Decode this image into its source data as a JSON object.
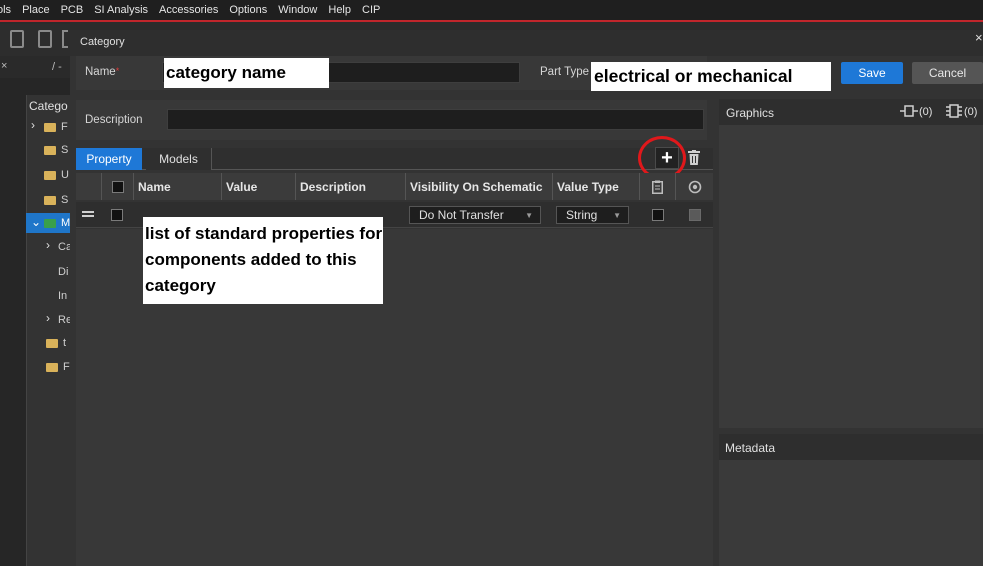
{
  "menubar": {
    "items": [
      "ols",
      "Place",
      "PCB",
      "SI Analysis",
      "Accessories",
      "Options",
      "Window",
      "Help",
      "CIP"
    ]
  },
  "background_tree": {
    "tab_close": "×",
    "tab_path": "/ -",
    "header": "Catego",
    "rows": [
      "F",
      "S",
      "U",
      "S",
      "M",
      "Ca",
      "Di",
      "In",
      "Re",
      "t",
      "F"
    ]
  },
  "dialog": {
    "title": "Category",
    "close": "×",
    "name_label": "Name",
    "name_required": "*",
    "part_type_label": "Part Type",
    "save_label": "Save",
    "cancel_label": "Cancel",
    "description_label": "Description",
    "tabs": [
      "Property",
      "Models"
    ],
    "add_glyph": "+",
    "columns": [
      "Name",
      "Value",
      "Description",
      "Visibility On Schematic",
      "Value Type"
    ],
    "row": {
      "visibility": "Do Not Transfer",
      "value_type": "String"
    },
    "graphics_label": "Graphics",
    "graphics_count_a": "(0)",
    "graphics_count_b": "(0)",
    "metadata_label": "Metadata"
  },
  "annotations": {
    "name_callout": "category name",
    "part_type_callout": "electrical or mechanical",
    "list_callout": "list of standard properties for components added to this category"
  },
  "colors": {
    "accent_blue": "#1e78d7",
    "menu_underline": "#c0252b",
    "highlight_circle": "#e0181b"
  }
}
